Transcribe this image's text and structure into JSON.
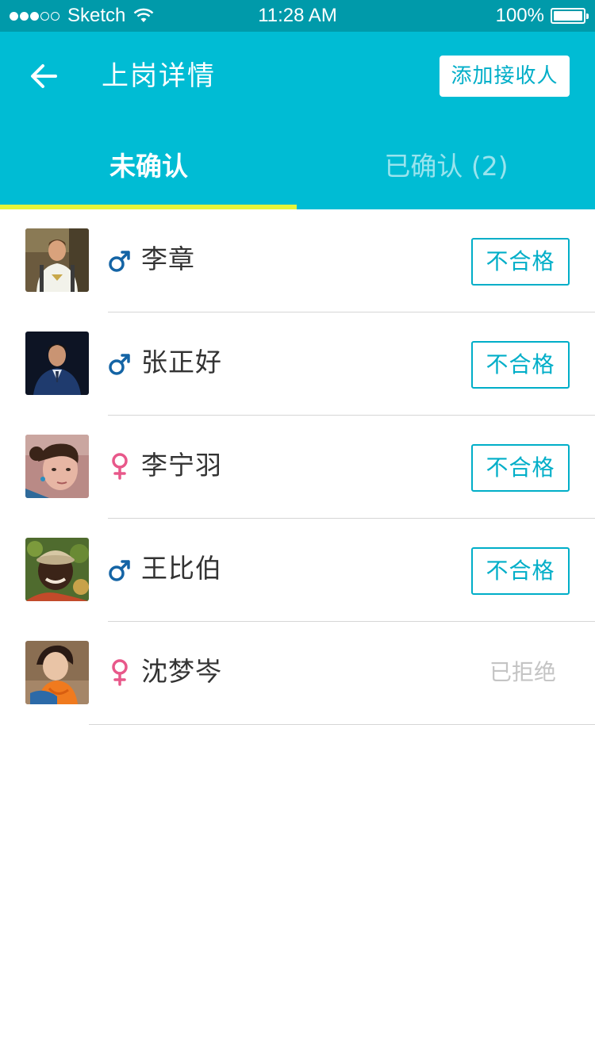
{
  "status_bar": {
    "carrier": "Sketch",
    "time": "11:28 AM",
    "battery": "100%"
  },
  "header": {
    "title": "上岗详情",
    "add_button": "添加接收人"
  },
  "tabs": [
    {
      "label": "未确认"
    },
    {
      "label": "已确认 (2)"
    }
  ],
  "colors": {
    "header_bg": "#00bcd4",
    "status_bg": "#009aaa",
    "accent": "#00aec8",
    "tab_indicator": "#e6f53a",
    "male": "#1464a5",
    "female": "#e8588a"
  },
  "people": [
    {
      "name": "李章",
      "gender": "male",
      "action": "不合格"
    },
    {
      "name": "张正好",
      "gender": "male",
      "action": "不合格"
    },
    {
      "name": "李宁羽",
      "gender": "female",
      "action": "不合格"
    },
    {
      "name": "王比伯",
      "gender": "male",
      "action": "不合格"
    },
    {
      "name": "沈梦岑",
      "gender": "female",
      "status": "已拒绝"
    }
  ]
}
